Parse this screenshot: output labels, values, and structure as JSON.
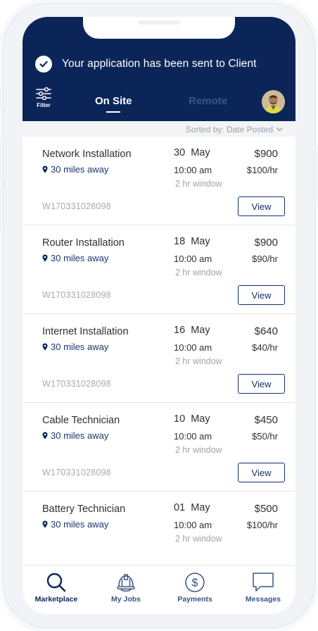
{
  "banner": {
    "message": "Your application has been sent to Client",
    "icon": "check-circle-icon"
  },
  "header": {
    "filter_label": "Filter",
    "tabs": [
      {
        "label": "On Site",
        "active": true
      },
      {
        "label": "Remote",
        "active": false
      }
    ]
  },
  "sort": {
    "label": "Sorted by: Date Posted"
  },
  "jobs": [
    {
      "title": "Network Installation",
      "distance": "30 miles away",
      "date_day": "30",
      "date_month": "May",
      "time": "10:00 am",
      "window": "2 hr window",
      "price": "$900",
      "rate": "$100/hr",
      "job_id": "W170331028098",
      "action": "View"
    },
    {
      "title": "Router Installation",
      "distance": "30 miles away",
      "date_day": "18",
      "date_month": "May",
      "time": "10:00 am",
      "window": "2 hr window",
      "price": "$900",
      "rate": "$90/hr",
      "job_id": "W170331028098",
      "action": "View"
    },
    {
      "title": "Internet Installation",
      "distance": "30 miles away",
      "date_day": "16",
      "date_month": "May",
      "time": "10:00 am",
      "window": "2 hr window",
      "price": "$640",
      "rate": "$40/hr",
      "job_id": "W170331028098",
      "action": "View"
    },
    {
      "title": "Cable Technician",
      "distance": "30 miles away",
      "date_day": "10",
      "date_month": "May",
      "time": "10:00 am",
      "window": "2 hr window",
      "price": "$450",
      "rate": "$50/hr",
      "job_id": "W170331028098",
      "action": "View"
    },
    {
      "title": "Battery Technician",
      "distance": "30 miles away",
      "date_day": "01",
      "date_month": "May",
      "time": "10:00 am",
      "window": "2 hr window",
      "price": "$500",
      "rate": "$100/hr"
    }
  ],
  "bottom_nav": [
    {
      "label": "Marketplace",
      "icon": "search-icon",
      "active": true
    },
    {
      "label": "My Jobs",
      "icon": "hard-hat-icon",
      "active": false
    },
    {
      "label": "Payments",
      "icon": "dollar-circle-icon",
      "active": false
    },
    {
      "label": "Messages",
      "icon": "chat-bubble-icon",
      "active": false
    }
  ],
  "colors": {
    "navy": "#0c2559",
    "accent_text": "#13306a",
    "muted": "#a0a4aa",
    "inactive_tab": "#3c5489"
  }
}
